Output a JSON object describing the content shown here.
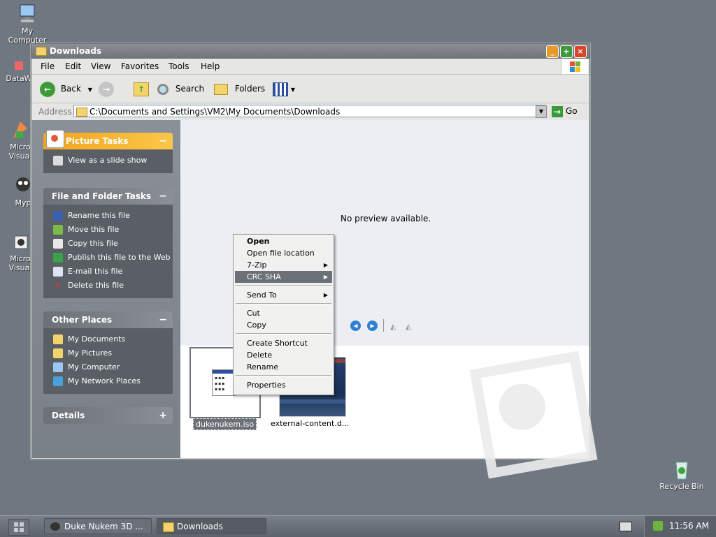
{
  "desktop": {
    "icons": [
      {
        "label": "My\nComputer"
      },
      {
        "label": "DataW"
      },
      {
        "label": "Micro\nVisual"
      },
      {
        "label": "Myp"
      },
      {
        "label": "Micro\nVisual"
      },
      {
        "label": "Recycle Bin"
      }
    ]
  },
  "window": {
    "title": "Downloads",
    "menu": [
      "File",
      "Edit",
      "View",
      "Favorites",
      "Tools",
      "Help"
    ],
    "toolbar": {
      "back": "Back",
      "search": "Search",
      "folders": "Folders"
    },
    "address": {
      "label": "Address",
      "value": "C:\\Documents and Settings\\VM2\\My Documents\\Downloads",
      "go": "Go"
    }
  },
  "leftpane": {
    "picture_tasks": {
      "title": "Picture Tasks",
      "toggle": "−",
      "items": [
        "View as a slide show"
      ]
    },
    "file_tasks": {
      "title": "File and Folder Tasks",
      "toggle": "−",
      "items": [
        "Rename this file",
        "Move this file",
        "Copy this file",
        "Publish this file to the Web",
        "E-mail this file",
        "Delete this file"
      ]
    },
    "other_places": {
      "title": "Other Places",
      "toggle": "−",
      "items": [
        "My Documents",
        "My Pictures",
        "My Computer",
        "My Network Places"
      ]
    },
    "details": {
      "title": "Details",
      "toggle": "+"
    }
  },
  "content": {
    "no_preview": "No preview available.",
    "files": [
      {
        "name": "dukenukem.iso",
        "selected": true
      },
      {
        "name": "external-content.d..."
      }
    ]
  },
  "context_menu": {
    "items": [
      "Open",
      "Open file location",
      "7-Zip",
      "CRC SHA",
      "Send To",
      "Cut",
      "Copy",
      "Create Shortcut",
      "Delete",
      "Rename",
      "Properties"
    ],
    "selected": "CRC SHA"
  },
  "taskbar": {
    "buttons": [
      "Duke Nukem 3D ...",
      "Downloads"
    ],
    "active": "Downloads",
    "clock": "11:56 AM"
  },
  "colors": {
    "accent_orange": "#f2a31d",
    "pane_dark": "#5a5f66",
    "selection": "#6c7077"
  }
}
